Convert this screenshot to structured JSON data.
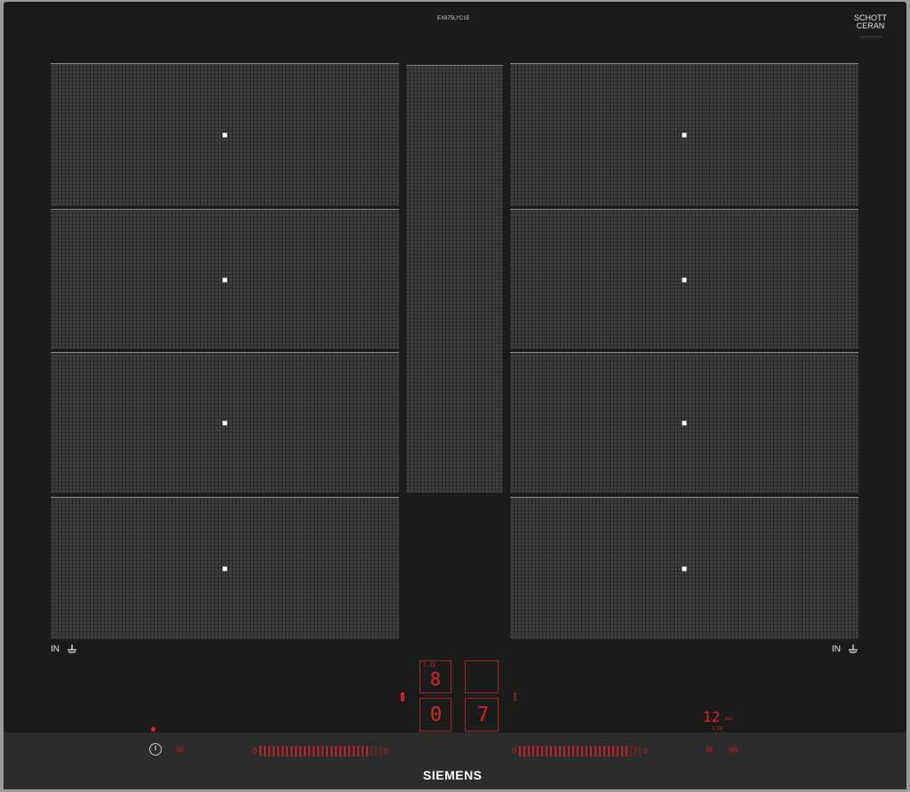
{
  "model_code": "EX875LYC1E",
  "schott_ceran": {
    "line1": "SCHOTT",
    "line2": "CERAN"
  },
  "zone_labels": {
    "left": "IN",
    "right": "IN"
  },
  "display": {
    "top_left_digit": "8",
    "top_left_label": "I-II",
    "bottom_left_digit": "0",
    "bottom_right_digit": "7",
    "timer_value": "12",
    "timer_unit": "min",
    "timer_sub": "I-II"
  },
  "slider_left": {
    "start_label": "0",
    "end_label": "9"
  },
  "slider_right": {
    "start_label": "0",
    "end_label": "9"
  },
  "brand": "SIEMENS",
  "colors": {
    "glass": "#1b1b1b",
    "zone": "#3d3d3d",
    "indicator_red": "#d8262b"
  }
}
